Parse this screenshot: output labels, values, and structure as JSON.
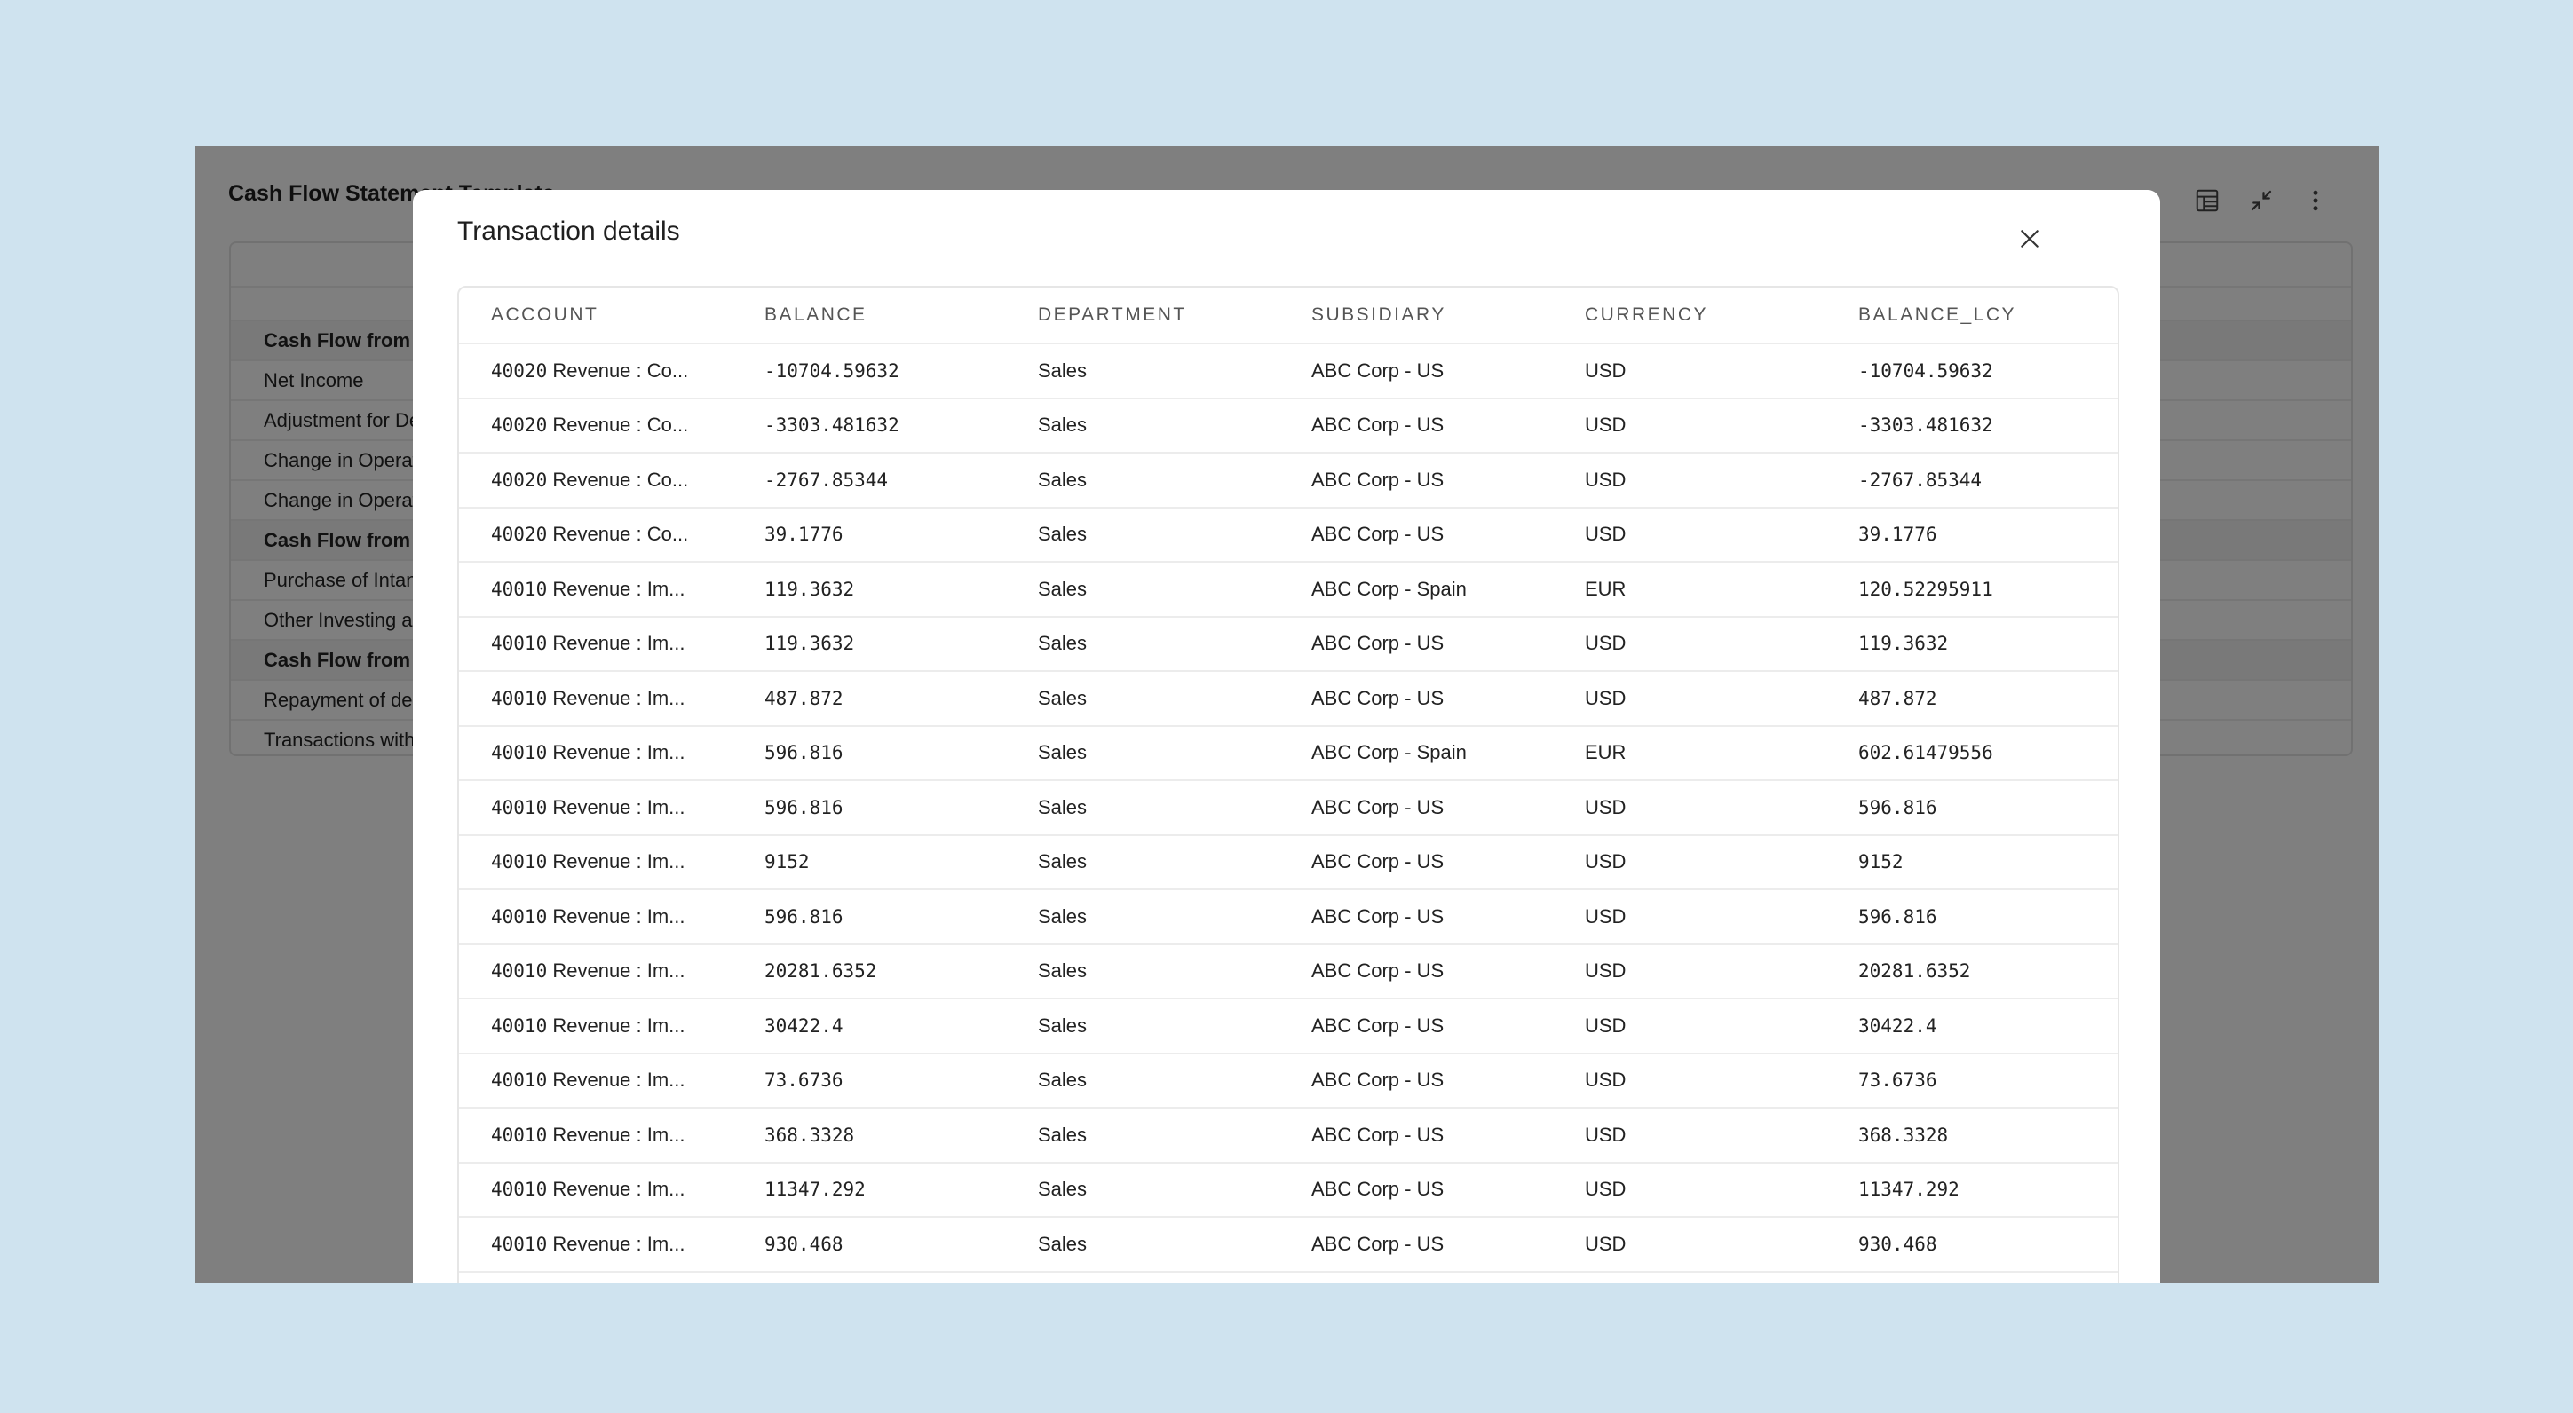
{
  "app": {
    "title": "Cash Flow Statement Template",
    "icons": [
      "table-layout-icon",
      "collapse-icon",
      "more-vertical-icon"
    ]
  },
  "background_report": {
    "rows": [
      {
        "label": "Cash Flow from Operating Activities",
        "bold": true
      },
      {
        "label": "Net Income",
        "bold": false
      },
      {
        "label": "Adjustment for Depreciation",
        "bold": false
      },
      {
        "label": "Change in Operating Assets",
        "bold": false
      },
      {
        "label": "Change in Operating Liabilities",
        "bold": false
      },
      {
        "label": "Cash Flow from Investing Activities",
        "bold": true
      },
      {
        "label": "Purchase of Intangible Assets",
        "bold": false
      },
      {
        "label": "Other Investing activities",
        "bold": false
      },
      {
        "label": "Cash Flow from Financing Activities",
        "bold": true
      },
      {
        "label": "Repayment of debt",
        "bold": false
      },
      {
        "label": "Transactions with owners",
        "bold": false
      }
    ]
  },
  "modal": {
    "title": "Transaction details",
    "close_icon": "close-icon",
    "columns": [
      "ACCOUNT",
      "BALANCE",
      "DEPARTMENT",
      "SUBSIDIARY",
      "CURRENCY",
      "BALANCE_LCY"
    ],
    "rows": [
      {
        "account_code": "40020",
        "account_name": "Revenue : Co...",
        "balance": "-10704.59632",
        "department": "Sales",
        "subsidiary": "ABC Corp - US",
        "currency": "USD",
        "balance_lcy": "-10704.59632"
      },
      {
        "account_code": "40020",
        "account_name": "Revenue : Co...",
        "balance": "-3303.481632",
        "department": "Sales",
        "subsidiary": "ABC Corp - US",
        "currency": "USD",
        "balance_lcy": "-3303.481632"
      },
      {
        "account_code": "40020",
        "account_name": "Revenue : Co...",
        "balance": "-2767.85344",
        "department": "Sales",
        "subsidiary": "ABC Corp - US",
        "currency": "USD",
        "balance_lcy": "-2767.85344"
      },
      {
        "account_code": "40020",
        "account_name": "Revenue : Co...",
        "balance": "39.1776",
        "department": "Sales",
        "subsidiary": "ABC Corp - US",
        "currency": "USD",
        "balance_lcy": "39.1776"
      },
      {
        "account_code": "40010",
        "account_name": "Revenue : Im...",
        "balance": "119.3632",
        "department": "Sales",
        "subsidiary": "ABC Corp - Spain",
        "currency": "EUR",
        "balance_lcy": "120.52295911"
      },
      {
        "account_code": "40010",
        "account_name": "Revenue : Im...",
        "balance": "119.3632",
        "department": "Sales",
        "subsidiary": "ABC Corp - US",
        "currency": "USD",
        "balance_lcy": "119.3632"
      },
      {
        "account_code": "40010",
        "account_name": "Revenue : Im...",
        "balance": "487.872",
        "department": "Sales",
        "subsidiary": "ABC Corp - US",
        "currency": "USD",
        "balance_lcy": "487.872"
      },
      {
        "account_code": "40010",
        "account_name": "Revenue : Im...",
        "balance": "596.816",
        "department": "Sales",
        "subsidiary": "ABC Corp - Spain",
        "currency": "EUR",
        "balance_lcy": "602.61479556"
      },
      {
        "account_code": "40010",
        "account_name": "Revenue : Im...",
        "balance": "596.816",
        "department": "Sales",
        "subsidiary": "ABC Corp - US",
        "currency": "USD",
        "balance_lcy": "596.816"
      },
      {
        "account_code": "40010",
        "account_name": "Revenue : Im...",
        "balance": "9152",
        "department": "Sales",
        "subsidiary": "ABC Corp - US",
        "currency": "USD",
        "balance_lcy": "9152"
      },
      {
        "account_code": "40010",
        "account_name": "Revenue : Im...",
        "balance": "596.816",
        "department": "Sales",
        "subsidiary": "ABC Corp - US",
        "currency": "USD",
        "balance_lcy": "596.816"
      },
      {
        "account_code": "40010",
        "account_name": "Revenue : Im...",
        "balance": "20281.6352",
        "department": "Sales",
        "subsidiary": "ABC Corp - US",
        "currency": "USD",
        "balance_lcy": "20281.6352"
      },
      {
        "account_code": "40010",
        "account_name": "Revenue : Im...",
        "balance": "30422.4",
        "department": "Sales",
        "subsidiary": "ABC Corp - US",
        "currency": "USD",
        "balance_lcy": "30422.4"
      },
      {
        "account_code": "40010",
        "account_name": "Revenue : Im...",
        "balance": "73.6736",
        "department": "Sales",
        "subsidiary": "ABC Corp - US",
        "currency": "USD",
        "balance_lcy": "73.6736"
      },
      {
        "account_code": "40010",
        "account_name": "Revenue : Im...",
        "balance": "368.3328",
        "department": "Sales",
        "subsidiary": "ABC Corp - US",
        "currency": "USD",
        "balance_lcy": "368.3328"
      },
      {
        "account_code": "40010",
        "account_name": "Revenue : Im...",
        "balance": "11347.292",
        "department": "Sales",
        "subsidiary": "ABC Corp - US",
        "currency": "USD",
        "balance_lcy": "11347.292"
      },
      {
        "account_code": "40010",
        "account_name": "Revenue : Im...",
        "balance": "930.468",
        "department": "Sales",
        "subsidiary": "ABC Corp - US",
        "currency": "USD",
        "balance_lcy": "930.468"
      }
    ]
  }
}
